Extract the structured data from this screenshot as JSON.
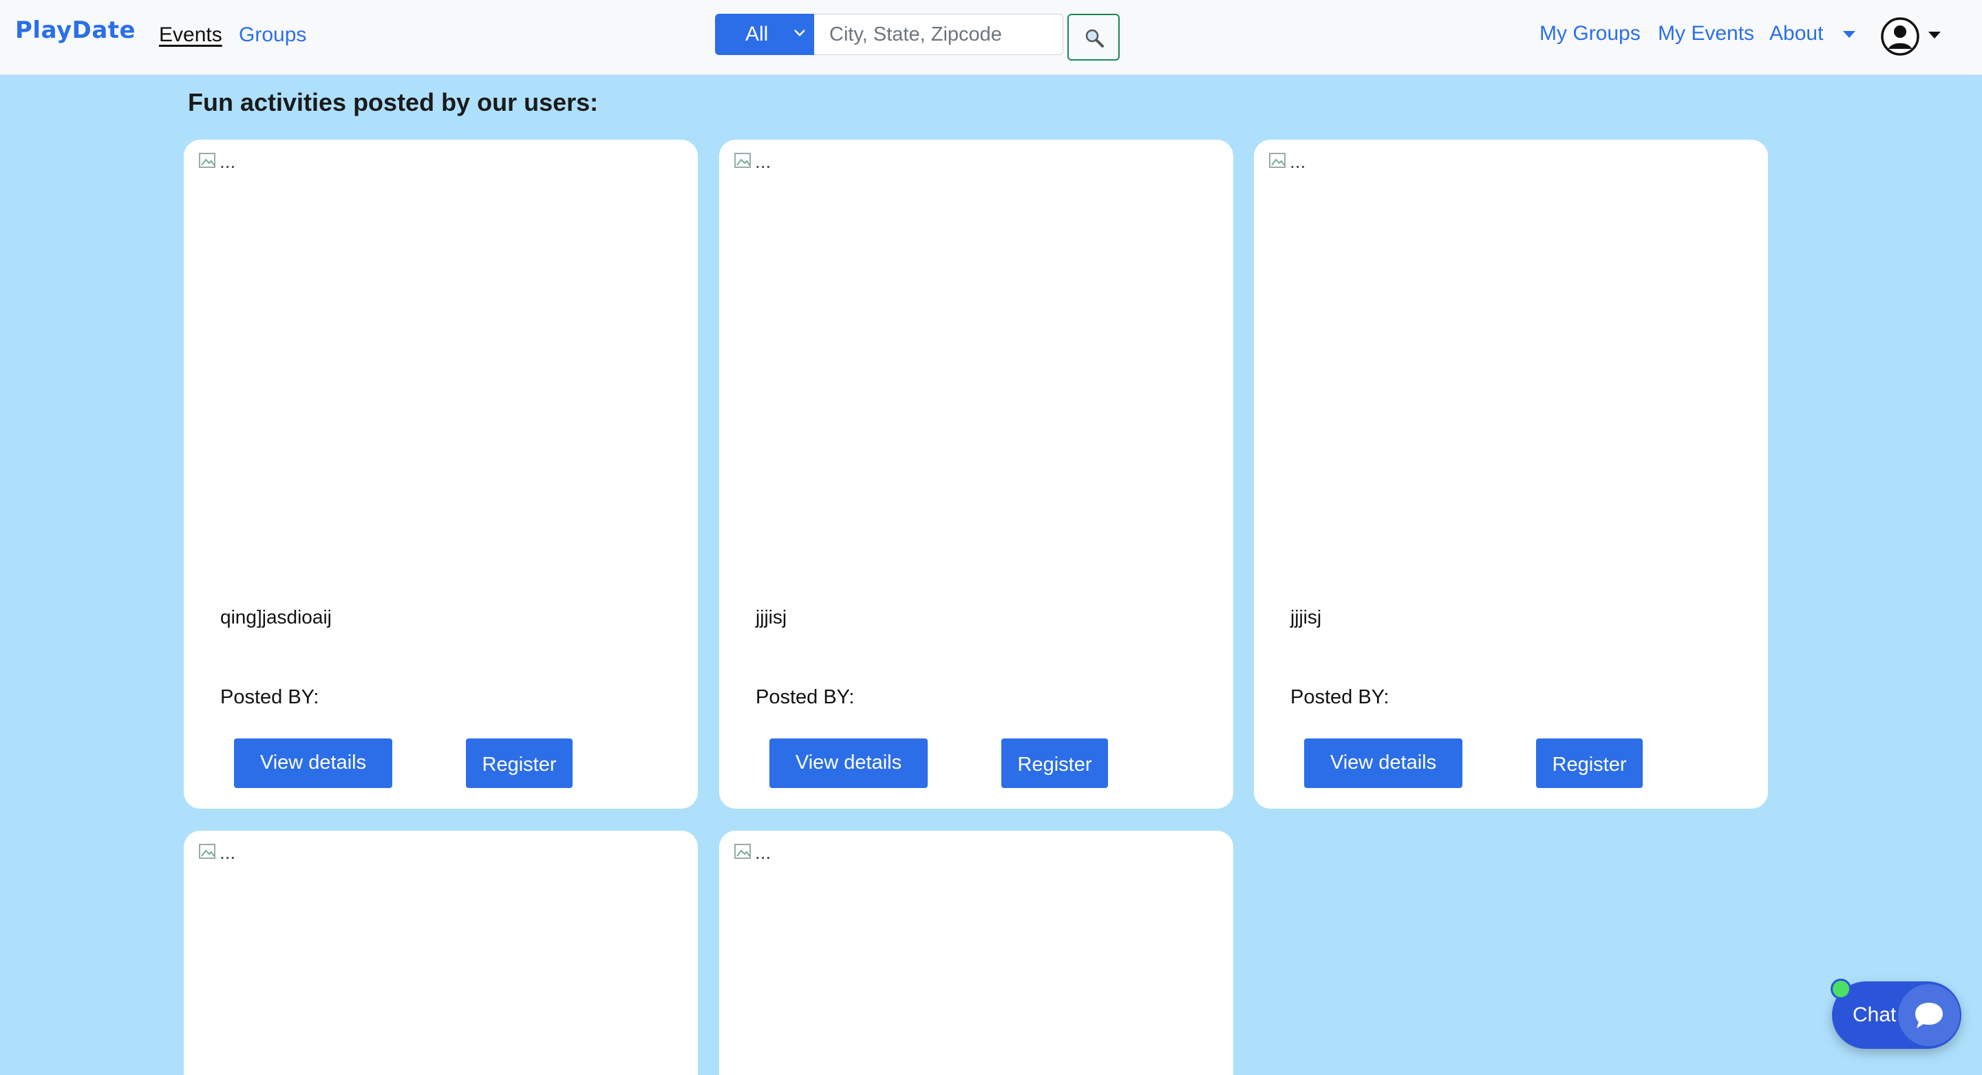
{
  "navbar": {
    "brand": "PlayDate",
    "links": [
      "Events",
      "Groups"
    ],
    "search": {
      "filter_value": "All",
      "placeholder": "City, State, Zipcode",
      "button_icon": "magnifier-icon"
    },
    "right_links": [
      "My Groups",
      "My Events",
      "About"
    ],
    "avatar_icon": "user-circle-icon"
  },
  "main": {
    "heading": "Fun activities posted by our users:",
    "cards": [
      {
        "image_alt": "...",
        "title": "qing]jasdioaij",
        "posted_by": "Posted BY:",
        "view_label": "View details",
        "register_label": "Register"
      },
      {
        "image_alt": "...",
        "title": "jjjisj",
        "posted_by": "Posted BY:",
        "view_label": "View details",
        "register_label": "Register"
      },
      {
        "image_alt": "...",
        "title": "jjjisj",
        "posted_by": "Posted BY:",
        "view_label": "View details",
        "register_label": "Register"
      },
      {
        "image_alt": "..."
      },
      {
        "image_alt": "..."
      }
    ]
  },
  "chat": {
    "label": "Chat",
    "status": "online"
  },
  "colors": {
    "accent": "#2b6ee8",
    "background": "#aee0fc",
    "online": "#4ce063"
  }
}
